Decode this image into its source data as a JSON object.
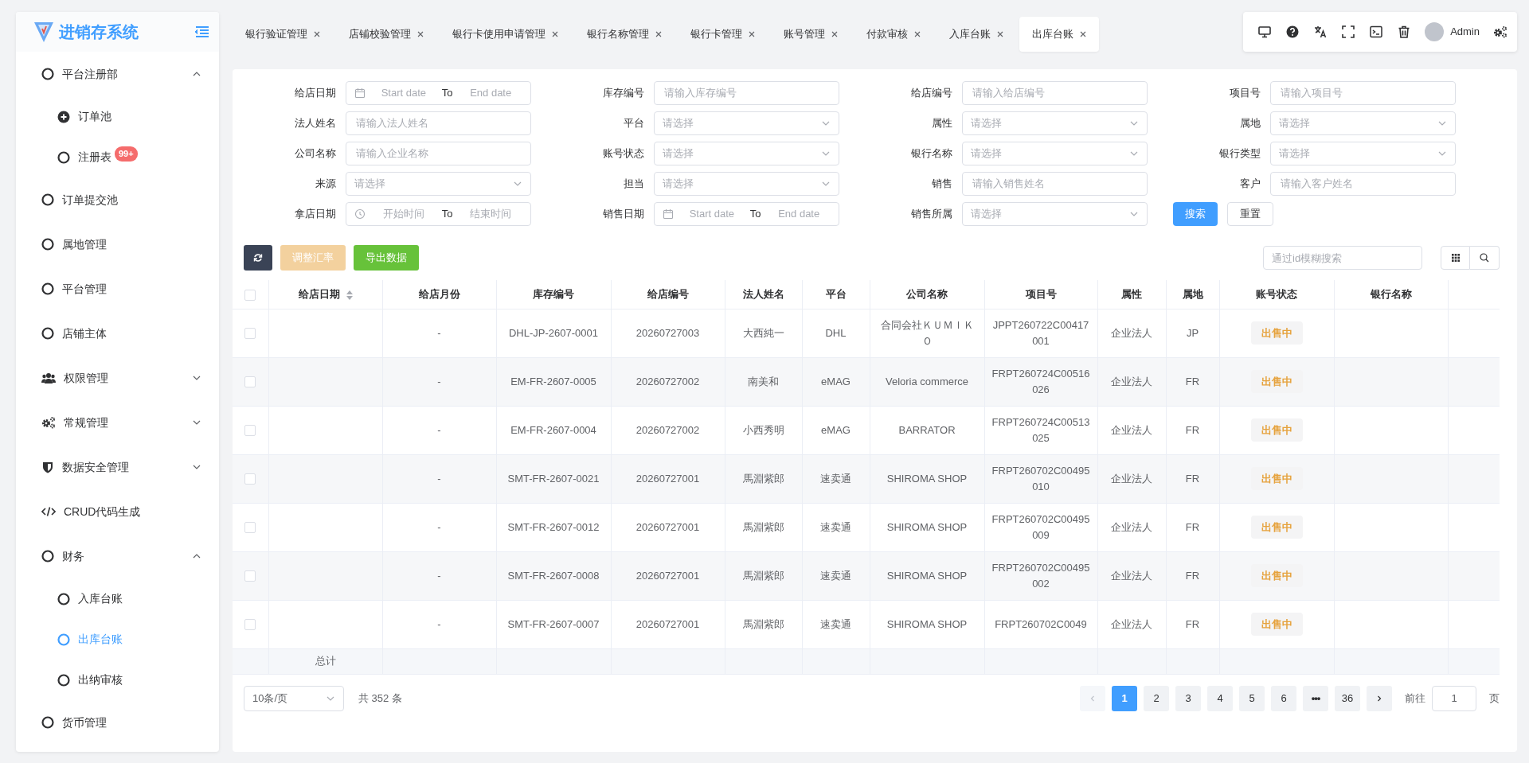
{
  "sidebar": {
    "title": "进销存系统",
    "items": [
      {
        "label": "平台注册部",
        "expanded": true,
        "selected": false,
        "children": [
          {
            "label": "订单池",
            "selected": false
          },
          {
            "label": "注册表",
            "badge": "99+",
            "selected": false
          }
        ]
      },
      {
        "label": "订单提交池",
        "selected": false
      },
      {
        "label": "属地管理",
        "selected": false
      },
      {
        "label": "平台管理",
        "selected": false
      },
      {
        "label": "店铺主体",
        "selected": false
      },
      {
        "label": "权限管理",
        "expanded": false,
        "selected": false
      },
      {
        "label": "常规管理",
        "expanded": false,
        "selected": false
      },
      {
        "label": "数据安全管理",
        "expanded": false,
        "selected": false
      },
      {
        "label": "CRUD代码生成",
        "selected": false
      },
      {
        "label": "财务",
        "expanded": true,
        "selected": false,
        "children": [
          {
            "label": "入库台账",
            "selected": false
          },
          {
            "label": "出库台账",
            "selected": true
          },
          {
            "label": "出纳审核",
            "selected": false
          }
        ]
      },
      {
        "label": "货币管理",
        "selected": false
      }
    ]
  },
  "tabs": [
    {
      "label": "银行验证管理",
      "selected": false
    },
    {
      "label": "店铺校验管理",
      "selected": false
    },
    {
      "label": "银行卡使用申请管理",
      "selected": false
    },
    {
      "label": "银行名称管理",
      "selected": false
    },
    {
      "label": "银行卡管理",
      "selected": false
    },
    {
      "label": "账号管理",
      "selected": false
    },
    {
      "label": "付款审核",
      "selected": false
    },
    {
      "label": "入库台账",
      "selected": false
    },
    {
      "label": "出库台账",
      "selected": true
    }
  ],
  "user": {
    "name": "Admin"
  },
  "filters": [
    {
      "label": "给店日期",
      "kind": "daterange",
      "start": "Start date",
      "separator": "To",
      "end": "End date"
    },
    {
      "label": "库存编号",
      "kind": "text",
      "placeholder": "请输入库存编号"
    },
    {
      "label": "给店编号",
      "kind": "text",
      "placeholder": "请输入给店编号"
    },
    {
      "label": "项目号",
      "kind": "text",
      "placeholder": "请输入项目号"
    },
    {
      "label": "法人姓名",
      "kind": "text",
      "placeholder": "请输入法人姓名"
    },
    {
      "label": "平台",
      "kind": "select",
      "placeholder": "请选择"
    },
    {
      "label": "属性",
      "kind": "select",
      "placeholder": "请选择"
    },
    {
      "label": "属地",
      "kind": "select",
      "placeholder": "请选择"
    },
    {
      "label": "公司名称",
      "kind": "text",
      "placeholder": "请输入企业名称"
    },
    {
      "label": "账号状态",
      "kind": "select",
      "placeholder": "请选择"
    },
    {
      "label": "银行名称",
      "kind": "select",
      "placeholder": "请选择"
    },
    {
      "label": "银行类型",
      "kind": "select",
      "placeholder": "请选择"
    },
    {
      "label": "来源",
      "kind": "select",
      "placeholder": "请选择"
    },
    {
      "label": "担当",
      "kind": "select",
      "placeholder": "请选择"
    },
    {
      "label": "销售",
      "kind": "text",
      "placeholder": "请输入销售姓名"
    },
    {
      "label": "客户",
      "kind": "text",
      "placeholder": "请输入客户姓名"
    },
    {
      "label": "拿店日期",
      "kind": "timerange",
      "start": "开始时间",
      "separator": "To",
      "end": "结束时间"
    },
    {
      "label": "销售日期",
      "kind": "daterange",
      "start": "Start date",
      "separator": "To",
      "end": "End date"
    },
    {
      "label": "销售所属",
      "kind": "select",
      "placeholder": "请选择"
    }
  ],
  "filter_buttons": {
    "search": "搜索",
    "reset": "重置"
  },
  "actions": [
    {
      "kind": "refresh",
      "disabled": false
    },
    {
      "kind": "warning",
      "label": "调整汇率",
      "disabled": true
    },
    {
      "kind": "success",
      "label": "导出数据",
      "disabled": false
    }
  ],
  "table_search": {
    "placeholder": "通过id模糊搜索"
  },
  "table": {
    "select_all": {
      "checked": false
    },
    "columns": [
      {
        "label": "给店日期",
        "sortable": true
      },
      {
        "label": "给店月份",
        "sortable": false
      },
      {
        "label": "库存编号",
        "sortable": false
      },
      {
        "label": "给店编号",
        "sortable": false
      },
      {
        "label": "法人姓名",
        "sortable": false
      },
      {
        "label": "平台",
        "sortable": false
      },
      {
        "label": "公司名称",
        "sortable": false
      },
      {
        "label": "项目号",
        "sortable": false
      },
      {
        "label": "属性",
        "sortable": false
      },
      {
        "label": "属地",
        "sortable": false
      },
      {
        "label": "账号状态",
        "sortable": false
      },
      {
        "label": "银行名称",
        "sortable": false
      }
    ],
    "rows": [
      {
        "checked": false,
        "month": "-",
        "stock_no": "DHL-JP-2607-0001",
        "shop_no": "20260727003",
        "legal_name": "大西純一",
        "platform": "DHL",
        "company": "合同会社ＫＵＭＩＫＯ",
        "project_no": "JPPT260722C00417001",
        "attribute": "企业法人",
        "region": "JP",
        "status": "出售中"
      },
      {
        "checked": false,
        "month": "-",
        "stock_no": "EM-FR-2607-0005",
        "shop_no": "20260727002",
        "legal_name": "南美和",
        "platform": "eMAG",
        "company": "Veloria commerce",
        "project_no": "FRPT260724C00516026",
        "attribute": "企业法人",
        "region": "FR",
        "status": "出售中"
      },
      {
        "checked": false,
        "month": "-",
        "stock_no": "EM-FR-2607-0004",
        "shop_no": "20260727002",
        "legal_name": "小西秀明",
        "platform": "eMAG",
        "company": "BARRATOR",
        "project_no": "FRPT260724C00513025",
        "attribute": "企业法人",
        "region": "FR",
        "status": "出售中"
      },
      {
        "checked": false,
        "month": "-",
        "stock_no": "SMT-FR-2607-0021",
        "shop_no": "20260727001",
        "legal_name": "馬淵紫郎",
        "platform": "速卖通",
        "company": "SHIROMA SHOP",
        "project_no": "FRPT260702C00495010",
        "attribute": "企业法人",
        "region": "FR",
        "status": "出售中"
      },
      {
        "checked": false,
        "month": "-",
        "stock_no": "SMT-FR-2607-0012",
        "shop_no": "20260727001",
        "legal_name": "馬淵紫郎",
        "platform": "速卖通",
        "company": "SHIROMA SHOP",
        "project_no": "FRPT260702C00495009",
        "attribute": "企业法人",
        "region": "FR",
        "status": "出售中"
      },
      {
        "checked": false,
        "month": "-",
        "stock_no": "SMT-FR-2607-0008",
        "shop_no": "20260727001",
        "legal_name": "馬淵紫郎",
        "platform": "速卖通",
        "company": "SHIROMA SHOP",
        "project_no": "FRPT260702C00495002",
        "attribute": "企业法人",
        "region": "FR",
        "status": "出售中"
      },
      {
        "checked": false,
        "month": "-",
        "stock_no": "SMT-FR-2607-0007",
        "shop_no": "20260727001",
        "legal_name": "馬淵紫郎",
        "platform": "速卖通",
        "company": "SHIROMA SHOP",
        "project_no": "FRPT260702C0049",
        "attribute": "企业法人",
        "region": "FR",
        "status": "出售中"
      }
    ],
    "summary_label": "总计"
  },
  "pagination": {
    "page_size": "10条/页",
    "total": "共 352 条",
    "pages": [
      {
        "label": "1",
        "selected": true
      },
      {
        "label": "2",
        "selected": false
      },
      {
        "label": "3",
        "selected": false
      },
      {
        "label": "4",
        "selected": false
      },
      {
        "label": "5",
        "selected": false
      },
      {
        "label": "6",
        "selected": false
      },
      {
        "label": "•••",
        "selected": false
      },
      {
        "label": "36",
        "selected": false
      }
    ],
    "prev_disabled": true,
    "goto_label": "前往",
    "goto_value": "1",
    "goto_suffix": "页"
  }
}
